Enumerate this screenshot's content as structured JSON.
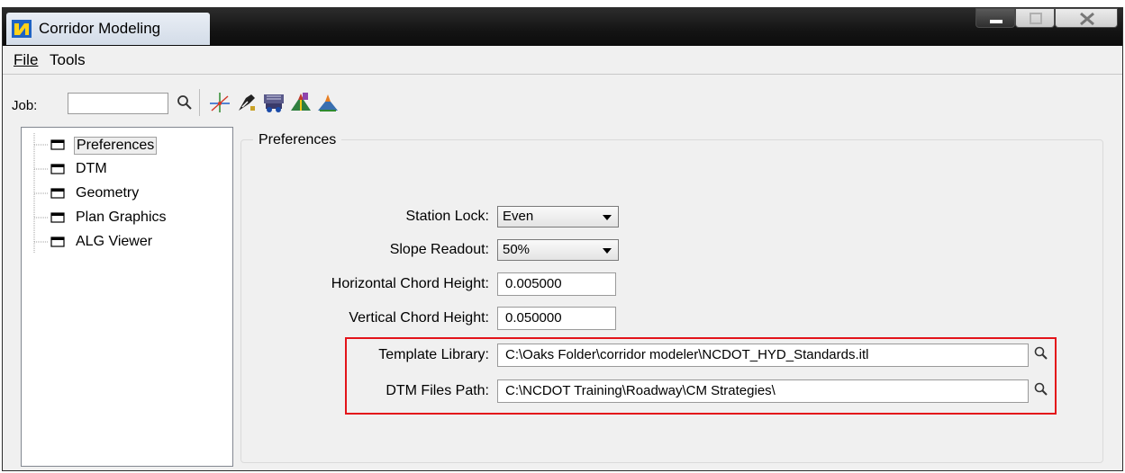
{
  "window": {
    "title": "Corridor Modeling"
  },
  "menu": {
    "file": "File",
    "tools": "Tools"
  },
  "toolbar": {
    "job_label": "Job:",
    "job_value": "",
    "icons": [
      "search-icon",
      "alignment-icon",
      "survey-icon",
      "roadway-icon",
      "corridor-icon",
      "template-icon"
    ]
  },
  "tree": {
    "items": [
      {
        "label": "Preferences",
        "selected": true
      },
      {
        "label": "DTM"
      },
      {
        "label": "Geometry"
      },
      {
        "label": "Plan Graphics"
      },
      {
        "label": "ALG Viewer"
      }
    ]
  },
  "preferences": {
    "title": "Preferences",
    "station_lock": {
      "label": "Station Lock:",
      "value": "Even"
    },
    "slope_readout": {
      "label": "Slope Readout:",
      "value": "50%"
    },
    "horizontal_chord": {
      "label": "Horizontal Chord Height:",
      "value": "0.005000"
    },
    "vertical_chord": {
      "label": "Vertical Chord Height:",
      "value": "0.050000"
    },
    "template_library": {
      "label": "Template Library:",
      "value": "C:\\Oaks Folder\\corridor modeler\\NCDOT_HYD_Standards.itl"
    },
    "dtm_files_path": {
      "label": "DTM Files Path:",
      "value": "C:\\NCDOT Training\\Roadway\\CM Strategies\\"
    }
  },
  "colors": {
    "highlight": "#e3141a",
    "titlebar": "#141414"
  }
}
